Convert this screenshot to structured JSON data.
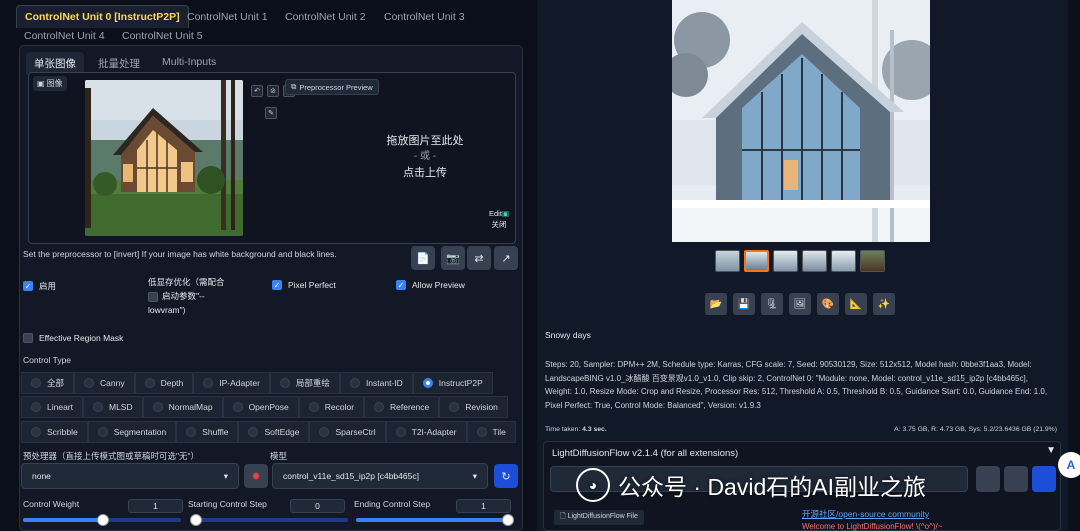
{
  "controlnet": {
    "unit_tabs": [
      "ControlNet Unit 0 [InstructP2P]",
      "ControlNet Unit 1",
      "ControlNet Unit 2",
      "ControlNet Unit 3",
      "ControlNet Unit 4",
      "ControlNet Unit 5"
    ],
    "sub_tabs": [
      "单张图像",
      "批量处理",
      "Multi-Inputs"
    ],
    "image_label": "图像",
    "preprocessor_preview": "Preprocessor Preview",
    "drop_text": [
      "拖放图片至此处",
      "- 或 -",
      "点击上传"
    ],
    "edit_label": "Edit",
    "close_label": "关闭",
    "hint": "Set the preprocessor to [invert] If your image has white background and black lines.",
    "enable_label": "启用",
    "lowvram_label": [
      "低显存优化（需配合",
      "启动参数\"--",
      "lowvram\")"
    ],
    "pixel_perfect_label": "Pixel Perfect",
    "allow_preview_label": "Allow Preview",
    "effective_region_label": "Effective Region Mask",
    "control_type_label": "Control Type",
    "control_types_row1": [
      "全部",
      "Canny",
      "Depth",
      "IP-Adapter",
      "局部重绘",
      "Instant-ID",
      "InstructP2P"
    ],
    "control_types_row2": [
      "Lineart",
      "MLSD",
      "NormalMap",
      "OpenPose",
      "Recolor",
      "Reference",
      "Revision"
    ],
    "control_types_row3": [
      "Scribble",
      "Segmentation",
      "Shuffle",
      "SoftEdge",
      "SparseCtrl",
      "T2I-Adapter",
      "Tile"
    ],
    "selected_type": "InstructP2P",
    "preprocessor_label": "预处理器（直接上传模式图或草稿时可选\"无\"）",
    "preprocessor_value": "none",
    "model_label": "模型",
    "model_value": "control_v11e_sd15_ip2p [c4bb465c]",
    "control_weight_label": "Control Weight",
    "control_weight_value": "1",
    "start_step_label": "Starting Control Step",
    "start_step_value": "0",
    "end_step_label": "Ending Control Step",
    "end_step_value": "1"
  },
  "output": {
    "prompt": "Snowy days",
    "params": "Steps: 20, Sampler: DPM++ 2M, Schedule type: Karras, CFG scale: 7, Seed: 90530129, Size: 512x512, Model hash: 0bbe3f1aa3, Model: LandscapeBING v1.0_冰醋酸 百变景观v1.0_v1.0, Clip skip: 2, ControlNet 0: \"Module: none, Model: control_v11e_sd15_ip2p [c4bb465c], Weight: 1.0, Resize Mode: Crop and Resize, Processor Res: 512, Threshold A: 0.5, Threshold B: 0.5, Guidance Start: 0.0, Guidance End: 1.0, Pixel Perfect: True, Control Mode: Balanced\", Version: v1.9.3",
    "time_taken_label": "Time taken:",
    "time_taken_value": "4.3 sec.",
    "vram": "A: 3.75 GB, R: 4.73 GB, Sys: 5.2/23.6436 GB (21.9%)"
  },
  "ldf": {
    "title": "LightDiffusionFlow v2.1.4 (for all extensions)",
    "file_button": "LightDiffusionFlow File",
    "link": "开源社区/open-source community",
    "welcome": "Welcome to LightDiffusionFlow! \\(^o^)/~"
  },
  "watermark": "公众号 · David石的AI副业之旅",
  "colors": {
    "accent": "#3b82f6",
    "active_tab": "#ffd84d",
    "selected_thumb": "#f97316"
  }
}
